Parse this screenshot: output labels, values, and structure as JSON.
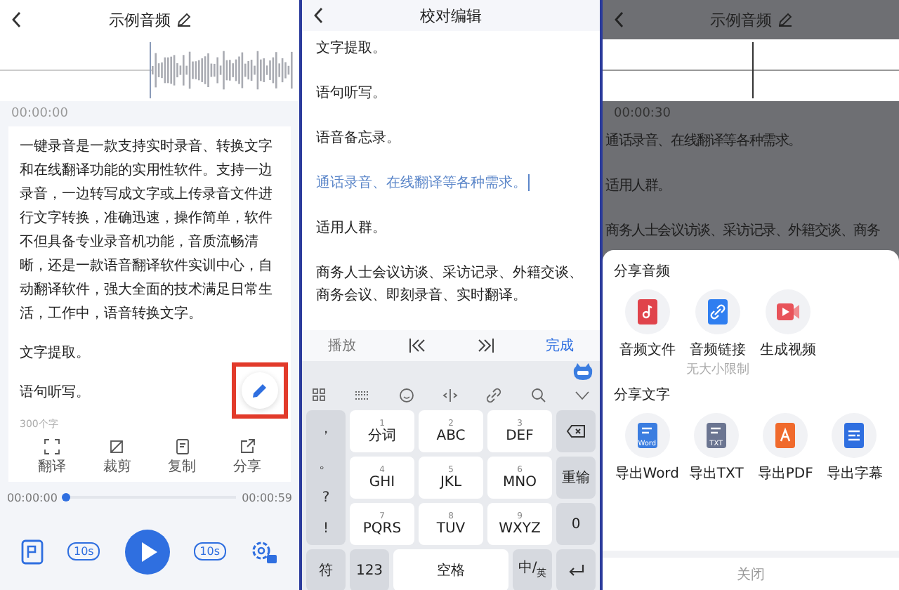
{
  "player_screen": {
    "title": "示例音频",
    "time": "00:00:00",
    "paragraphs": [
      "一键录音是一款支持实时录音、转换文字和在线翻译功能的实用性软件。支持一边录音，一边转写成文字或上传录音文件进行文字转换，准确迅速，操作简单，软件不但具备专业录音机功能，音质流畅清晰，还是一款语音翻译软件实训中心，自动翻译软件，强大全面的技术满足日常生活，工作中，语音转换文字。",
      "文字提取。",
      "语句听写。"
    ],
    "edit_button": {
      "highlighted": true
    },
    "word_count": "300个字",
    "tools": [
      {
        "kind": "translate",
        "label": "翻译"
      },
      {
        "kind": "crop",
        "label": "裁剪"
      },
      {
        "kind": "copy",
        "label": "复制"
      },
      {
        "kind": "share",
        "label": "分享"
      }
    ],
    "progress": {
      "current": "00:00:00",
      "total": "00:00:59",
      "level": 0.02
    },
    "controls": [
      {
        "kind": "transcript"
      },
      {
        "kind": "rewind",
        "text": "10s"
      },
      {
        "kind": "play"
      },
      {
        "kind": "forward",
        "text": "10s"
      },
      {
        "kind": "settings"
      }
    ]
  },
  "editor_screen": {
    "title": "校对编辑",
    "paragraphs": [
      {
        "text": "文字提取。",
        "selected": false
      },
      {
        "text": "语句听写。",
        "selected": false
      },
      {
        "text": "语音备忘录。",
        "selected": false
      },
      {
        "text": "通话录音、在线翻译等各种需求。",
        "selected": true
      },
      {
        "text": "适用人群。",
        "selected": false
      },
      {
        "text": "商务人士会议访谈、采访记录、外籍交谈、商务会议、即刻录音、实时翻译。",
        "selected": false
      }
    ],
    "toolbar": [
      {
        "kind": "text",
        "label": "播放"
      },
      {
        "kind": "prev"
      },
      {
        "kind": "next"
      },
      {
        "kind": "done",
        "label": "完成"
      }
    ],
    "keyboard": {
      "symbols": [
        "，",
        "。",
        "?",
        "!"
      ],
      "rows": [
        [
          {
            "kind": "key",
            "digit": "1",
            "label": "分词"
          },
          {
            "kind": "key",
            "digit": "2",
            "label": "ABC"
          },
          {
            "kind": "key",
            "digit": "3",
            "label": "DEF"
          },
          {
            "kind": "backspace"
          }
        ],
        [
          {
            "kind": "key",
            "digit": "4",
            "label": "GHI"
          },
          {
            "kind": "key",
            "digit": "5",
            "label": "JKL"
          },
          {
            "kind": "key",
            "digit": "6",
            "label": "MNO"
          },
          {
            "kind": "func",
            "label": "重输"
          }
        ],
        [
          {
            "kind": "key",
            "digit": "7",
            "label": "PQRS"
          },
          {
            "kind": "key",
            "digit": "8",
            "label": "TUV"
          },
          {
            "kind": "key",
            "digit": "9",
            "label": "WXYZ"
          },
          {
            "kind": "func",
            "label": "0"
          }
        ]
      ],
      "bottom": [
        {
          "kind": "func",
          "label": "符"
        },
        {
          "kind": "func",
          "label": "123"
        },
        {
          "kind": "space",
          "label": "空格"
        },
        {
          "kind": "lang",
          "label": "中/$_{英}$"
        },
        {
          "kind": "enter"
        }
      ]
    }
  },
  "share_screen": {
    "title": "示例音频",
    "time": "00:00:30",
    "paragraphs": [
      "通话录音、在线翻译等各种需求。",
      "适用人群。",
      "商务人士会议访谈、采访记录、外籍交谈、商务"
    ],
    "sections": [
      {
        "title": "分享音频",
        "items": [
          {
            "kind": "audio-file",
            "label": "音频文件"
          },
          {
            "kind": "link",
            "label": "音频链接",
            "note": "无大小限制"
          },
          {
            "kind": "video",
            "label": "生成视频"
          }
        ]
      },
      {
        "title": "分享文字",
        "items": [
          {
            "kind": "word",
            "label": "导出Word",
            "badge": "Word"
          },
          {
            "kind": "txt",
            "label": "导出TXT",
            "badge": "TXT"
          },
          {
            "kind": "pdf",
            "label": "导出PDF"
          },
          {
            "kind": "subtitle",
            "label": "导出字幕"
          }
        ]
      }
    ],
    "close": "关闭"
  }
}
